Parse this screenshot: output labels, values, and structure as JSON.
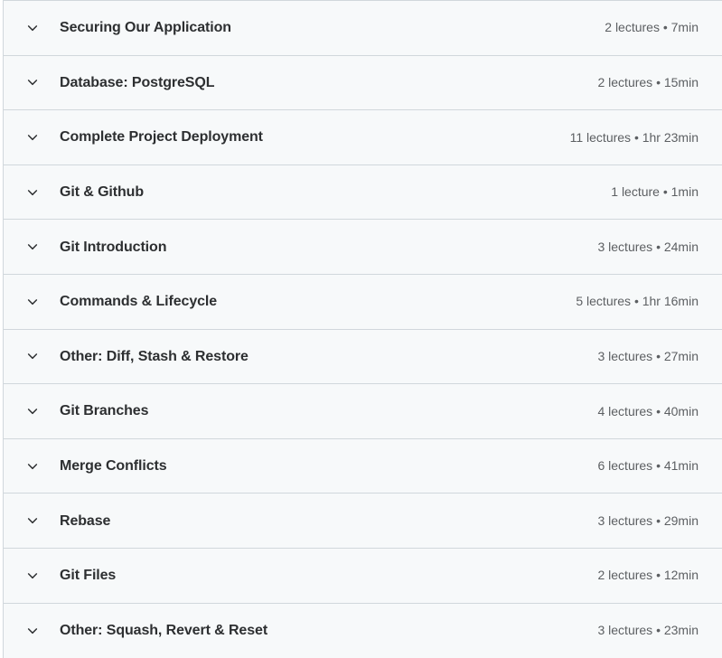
{
  "panel": {
    "name": "course-curriculum-accordion",
    "background_color": "#f7f9fa",
    "border_color": "#d1d7dc",
    "title_color": "#2d2f31",
    "meta_color": "#5c5f62"
  },
  "sections": [
    {
      "title": "Securing Our Application",
      "meta": "2 lectures • 7min",
      "lectures": "2 lectures",
      "duration": "7min",
      "expanded": false,
      "toggle_icon": "chevron-down-icon"
    },
    {
      "title": "Database: PostgreSQL",
      "meta": "2 lectures • 15min",
      "lectures": "2 lectures",
      "duration": "15min",
      "expanded": false,
      "toggle_icon": "chevron-down-icon"
    },
    {
      "title": "Complete Project Deployment",
      "meta": "11 lectures • 1hr 23min",
      "lectures": "11 lectures",
      "duration": "1hr 23min",
      "expanded": false,
      "toggle_icon": "chevron-down-icon"
    },
    {
      "title": "Git & Github",
      "meta": "1 lecture • 1min",
      "lectures": "1 lecture",
      "duration": "1min",
      "expanded": false,
      "toggle_icon": "chevron-down-icon"
    },
    {
      "title": "Git Introduction",
      "meta": "3 lectures • 24min",
      "lectures": "3 lectures",
      "duration": "24min",
      "expanded": false,
      "toggle_icon": "chevron-down-icon"
    },
    {
      "title": "Commands & Lifecycle",
      "meta": "5 lectures • 1hr 16min",
      "lectures": "5 lectures",
      "duration": "1hr 16min",
      "expanded": false,
      "toggle_icon": "chevron-down-icon"
    },
    {
      "title": "Other: Diff, Stash & Restore",
      "meta": "3 lectures • 27min",
      "lectures": "3 lectures",
      "duration": "27min",
      "expanded": false,
      "toggle_icon": "chevron-down-icon"
    },
    {
      "title": "Git Branches",
      "meta": "4 lectures • 40min",
      "lectures": "4 lectures",
      "duration": "40min",
      "expanded": false,
      "toggle_icon": "chevron-down-icon"
    },
    {
      "title": "Merge Conflicts",
      "meta": "6 lectures • 41min",
      "lectures": "6 lectures",
      "duration": "41min",
      "expanded": false,
      "toggle_icon": "chevron-down-icon"
    },
    {
      "title": "Rebase",
      "meta": "3 lectures • 29min",
      "lectures": "3 lectures",
      "duration": "29min",
      "expanded": false,
      "toggle_icon": "chevron-down-icon"
    },
    {
      "title": "Git Files",
      "meta": "2 lectures • 12min",
      "lectures": "2 lectures",
      "duration": "12min",
      "expanded": false,
      "toggle_icon": "chevron-down-icon"
    },
    {
      "title": "Other: Squash, Revert & Reset",
      "meta": "3 lectures • 23min",
      "lectures": "3 lectures",
      "duration": "23min",
      "expanded": false,
      "toggle_icon": "chevron-down-icon"
    }
  ]
}
